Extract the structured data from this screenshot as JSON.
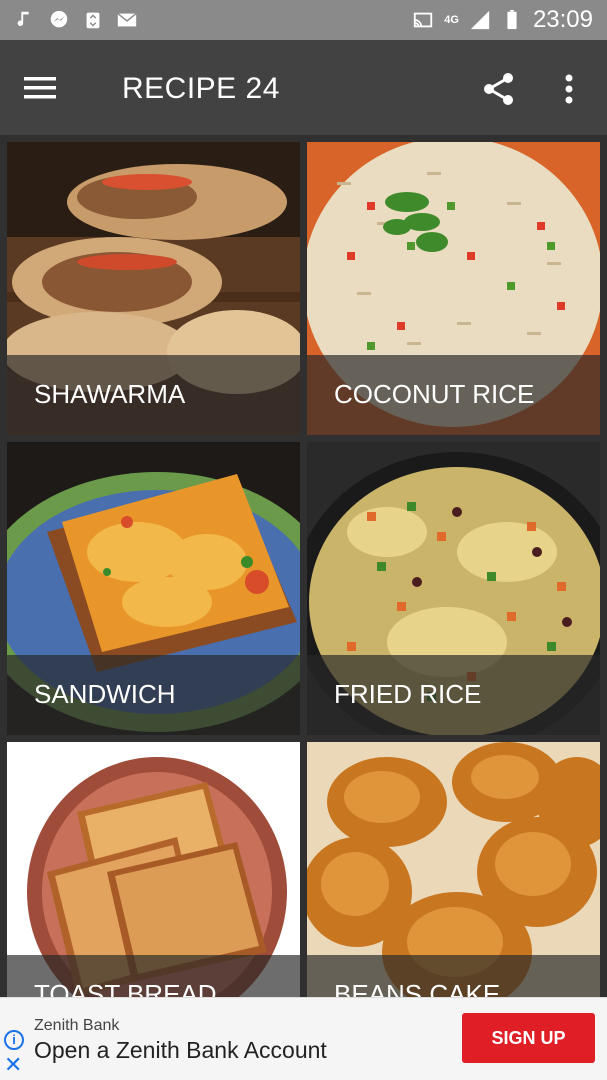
{
  "status_bar": {
    "time": "23:09",
    "network": "4G",
    "icons": [
      "music-note-icon",
      "messenger-icon",
      "recycle-icon",
      "mail-icon",
      "cast-icon",
      "signal-icon",
      "battery-icon"
    ]
  },
  "app_bar": {
    "title": "RECIPE 24",
    "menu_icon": "hamburger-menu-icon",
    "share_icon": "share-icon",
    "more_icon": "more-vert-icon"
  },
  "recipes": [
    {
      "label": "SHAWARMA"
    },
    {
      "label": "COCONUT RICE"
    },
    {
      "label": "SANDWICH"
    },
    {
      "label": "FRIED RICE"
    },
    {
      "label": "TOAST BREAD"
    },
    {
      "label": "BEANS CAKE"
    }
  ],
  "ad": {
    "advertiser": "Zenith Bank",
    "headline": "Open a Zenith Bank Account",
    "cta": "SIGN UP",
    "info_glyph": "i",
    "close_glyph": "✕"
  },
  "colors": {
    "app_bar": "#424242",
    "status_bar": "#8a8a8a",
    "cta": "#e01e25"
  }
}
